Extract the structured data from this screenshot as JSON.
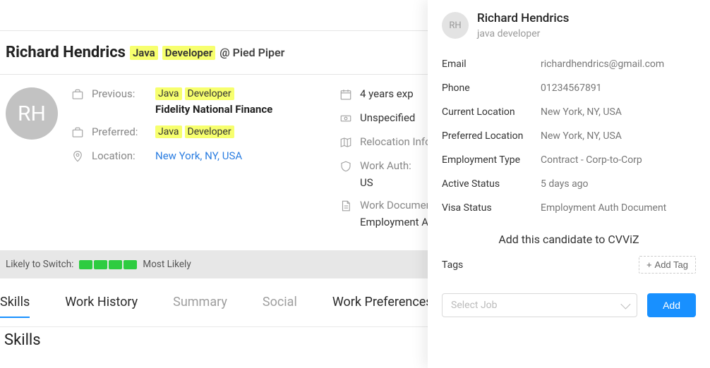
{
  "header": {
    "name": "Richard Hendrics",
    "tag1": "Java",
    "tag2": "Developer",
    "at": "@ Pied Piper"
  },
  "avatar_initials": "RH",
  "left_col": {
    "previous_label": "Previous:",
    "previous_tag1": "Java",
    "previous_tag2": "Developer",
    "previous_company": "Fidelity National Finance",
    "preferred_label": "Preferred:",
    "preferred_tag1": "Java",
    "preferred_tag2": "Developer",
    "location_label": "Location:",
    "location_value": "New York, NY, USA"
  },
  "right_col": {
    "exp_value": "4 years exp",
    "salary_value": "Unspecified",
    "relocation_label": "Relocation Info:",
    "work_auth_label": "Work Auth:",
    "work_auth_value": "US",
    "work_doc_label": "Work Documents:",
    "work_doc_value": "Employment Auth Document"
  },
  "switch": {
    "label": "Likely to Switch:",
    "result": "Most Likely"
  },
  "tabs": {
    "skills": "Skills",
    "work_history": "Work History",
    "summary": "Summary",
    "social": "Social",
    "work_pref": "Work Preferences"
  },
  "section_heading": "Skills",
  "panel": {
    "initials": "RH",
    "name": "Richard Hendrics",
    "role": "java developer",
    "rows": {
      "email_label": "Email",
      "email_value": "richardhendrics@gmail.com",
      "phone_label": "Phone",
      "phone_value": "01234567891",
      "curloc_label": "Current Location",
      "curloc_value": "New York, NY, USA",
      "prefloc_label": "Preferred Location",
      "prefloc_value": "New York, NY, USA",
      "emptype_label": "Employment Type",
      "emptype_value": "Contract - Corp-to-Corp",
      "active_label": "Active Status",
      "active_value": "5 days ago",
      "visa_label": "Visa Status",
      "visa_value": "Employment Auth Document"
    },
    "add_heading": "Add this candidate to CVViZ",
    "tags_label": "Tags",
    "add_tag_label": "Add Tag",
    "select_job_placeholder": "Select Job",
    "add_button": "Add"
  }
}
